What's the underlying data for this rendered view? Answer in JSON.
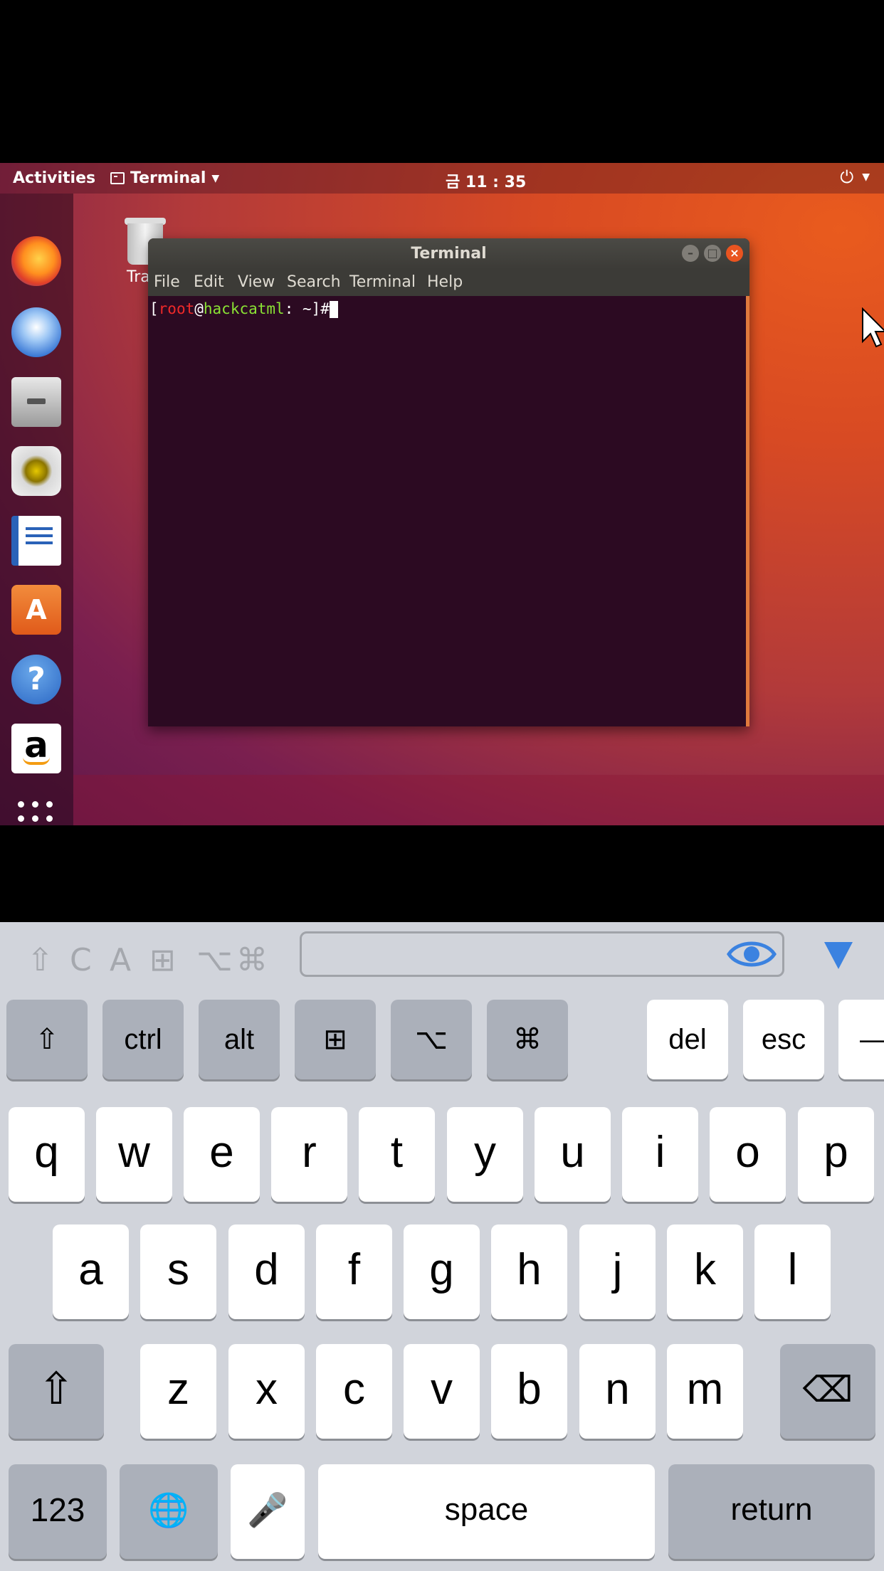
{
  "topbar": {
    "activities": "Activities",
    "app_menu": "Terminal",
    "clock": "금 11 : 35"
  },
  "desktop": {
    "trash_label": "Tra"
  },
  "terminal": {
    "title": "Terminal",
    "menu": [
      "File",
      "Edit",
      "View",
      "Search",
      "Terminal",
      "Help"
    ],
    "prompt": {
      "open": "[",
      "user": "root",
      "at": "@",
      "host": "hackcatml",
      "path": ": ~]#"
    }
  },
  "dock": {
    "icons": [
      "firefox-icon",
      "thunderbird-icon",
      "files-icon",
      "rhythmbox-icon",
      "libreoffice-writer-icon",
      "software-store-icon",
      "help-icon",
      "amazon-icon",
      "show-apps-icon"
    ]
  },
  "keyboard": {
    "accessory": {
      "mods": [
        "⇧",
        "C",
        "A",
        "⊞",
        "⌥",
        "⌘"
      ],
      "input_value": ""
    },
    "modifier_keys": {
      "shift": "⇧",
      "ctrl": "ctrl",
      "alt": "alt",
      "win": "⊞",
      "option": "⌥",
      "cmd": "⌘",
      "del": "del",
      "esc": "esc",
      "dash": "—"
    },
    "row1": [
      "q",
      "w",
      "e",
      "r",
      "t",
      "y",
      "u",
      "i",
      "o",
      "p"
    ],
    "row2": [
      "a",
      "s",
      "d",
      "f",
      "g",
      "h",
      "j",
      "k",
      "l"
    ],
    "row3": [
      "z",
      "x",
      "c",
      "v",
      "b",
      "n",
      "m"
    ],
    "bottom": {
      "numbers": "123",
      "globe": "🌐",
      "mic": "🎤",
      "space": "space",
      "return": "return",
      "shift": "⇧",
      "backspace": "⌫"
    }
  },
  "colors": {
    "ubuntu_orange": "#e95420",
    "terminal_bg": "#2c0a22",
    "prompt_user": "#ef2929",
    "prompt_host": "#8ae234",
    "keyboard_bg": "#d1d4db",
    "accent_blue": "#3b82e0"
  }
}
